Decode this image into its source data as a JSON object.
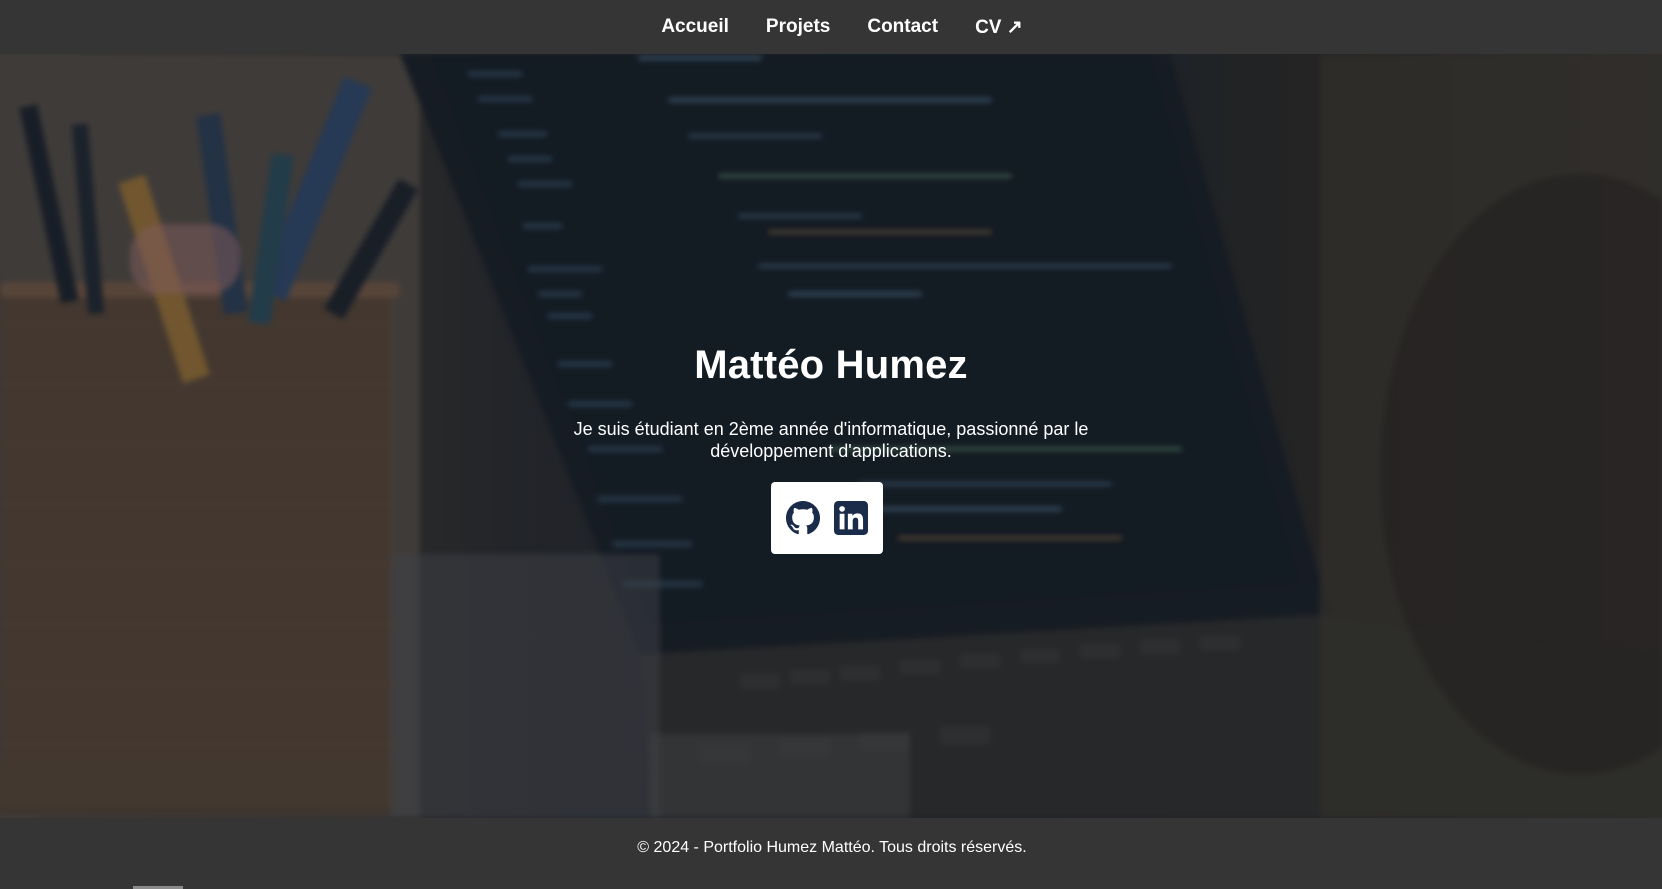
{
  "nav": {
    "items": [
      {
        "label": "Accueil"
      },
      {
        "label": "Projets"
      },
      {
        "label": "Contact"
      },
      {
        "label": "CV ↗"
      }
    ]
  },
  "hero": {
    "title": "Mattéo Humez",
    "description": "Je suis étudiant en 2ème année d'informatique, passionné par le développement d'applications.",
    "socials": [
      {
        "icon": "github-icon"
      },
      {
        "icon": "linkedin-icon"
      }
    ],
    "icon_color": "#1b2b4a"
  },
  "footer": {
    "text": "© 2024 - Portfolio Humez Mattéo. Tous droits réservés."
  }
}
